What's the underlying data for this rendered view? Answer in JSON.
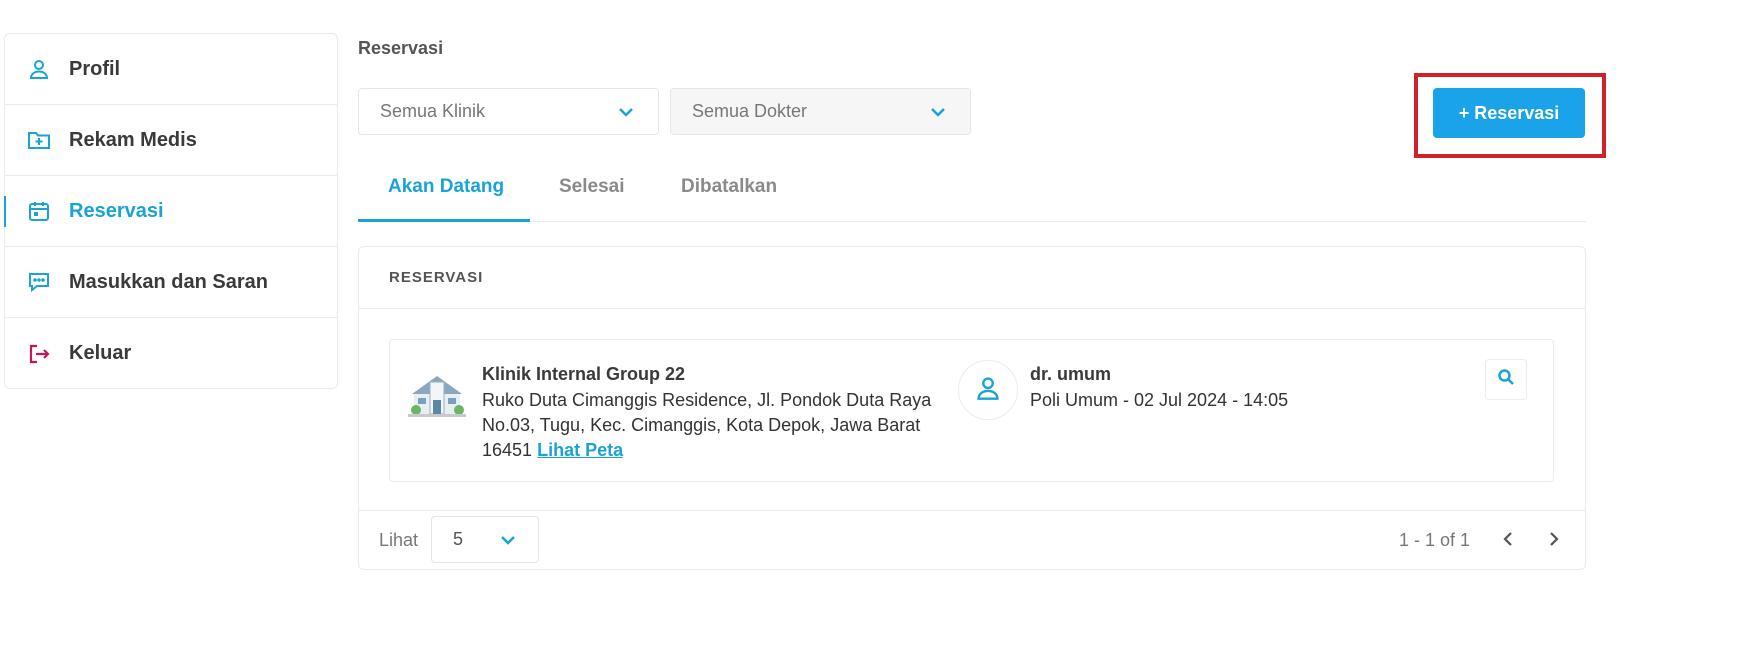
{
  "sidebar": {
    "items": [
      {
        "label": "Profil",
        "icon": "user-icon"
      },
      {
        "label": "Rekam Medis",
        "icon": "folder-plus-icon"
      },
      {
        "label": "Reservasi",
        "icon": "calendar-icon",
        "active": true
      },
      {
        "label": "Masukkan dan Saran",
        "icon": "chat-icon"
      },
      {
        "label": "Keluar",
        "icon": "logout-icon"
      }
    ]
  },
  "main": {
    "title": "Reservasi",
    "filters": {
      "clinic": "Semua Klinik",
      "doctor": "Semua Dokter"
    },
    "add_button": "+ Reservasi",
    "tabs": [
      {
        "label": "Akan Datang",
        "active": true
      },
      {
        "label": "Selesai"
      },
      {
        "label": "Dibatalkan"
      }
    ],
    "panel_header": "RESERVASI",
    "reservation": {
      "clinic_name": "Klinik Internal Group 22",
      "address": "Ruko Duta Cimanggis Residence, Jl. Pondok Duta Raya No.03, Tugu, Kec. Cimanggis, Kota Depok, Jawa Barat 16451",
      "map_link": "Lihat Peta",
      "doctor": "dr. umum",
      "schedule": "Poli Umum - 02 Jul 2024 - 14:05"
    },
    "footer": {
      "lihat_label": "Lihat",
      "per_page": "5",
      "range": "1 - 1 of 1"
    }
  },
  "colors": {
    "accent": "#1aa3d6",
    "button": "#1aa3e8",
    "highlight": "#d0212b",
    "logout": "#c2185b"
  }
}
